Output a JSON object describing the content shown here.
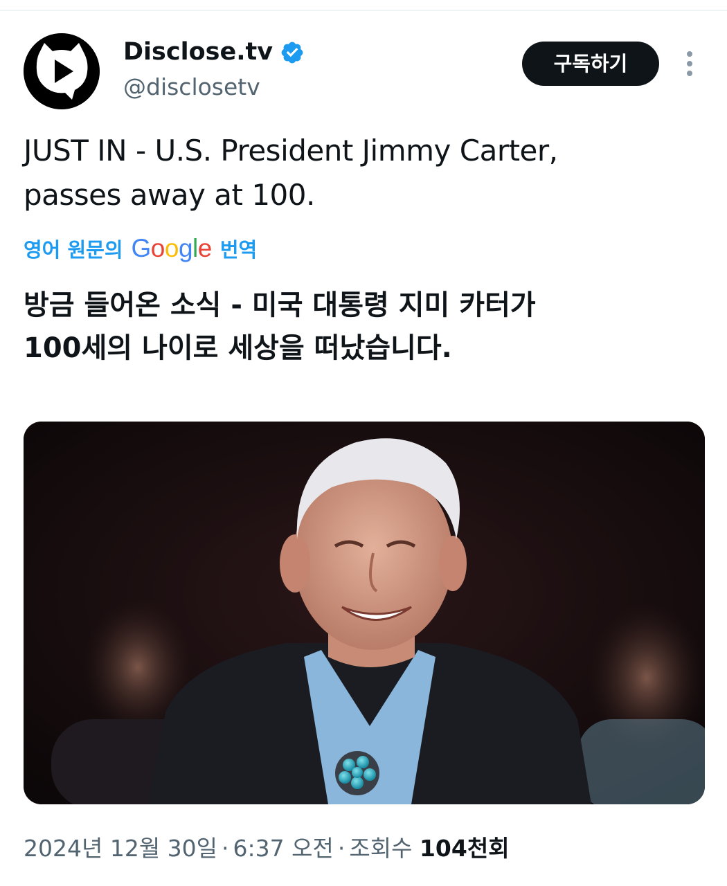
{
  "author": {
    "name": "Disclose.tv",
    "handle": "@disclosetv",
    "verified": true,
    "avatar_icon": "play-speech-bubble-icon"
  },
  "actions": {
    "subscribe_label": "구독하기",
    "more_icon": "more-vertical-icon"
  },
  "tweet": {
    "text_lines": [
      "JUST IN - U.S. President Jimmy Carter,",
      "passes away at 100."
    ],
    "translation": {
      "label_prefix": "영어 원문의",
      "google": [
        "G",
        "o",
        "o",
        "g",
        "l",
        "e"
      ],
      "label_suffix": "번역",
      "text_lines": [
        "방금 들어온 소식 - 미국 대통령 지미 카터가",
        "100세의 나이로 세상을 떠났습니다."
      ]
    }
  },
  "meta": {
    "date": "2024년 12월 30일",
    "separator": "·",
    "time": "6:37 오전",
    "views_label": "조회수",
    "views_count": "104천회"
  },
  "colors": {
    "text": "#0f1419",
    "secondary": "#536471",
    "link": "#1d9bf0",
    "verified": "#1d9bf0",
    "button_bg": "#0f1419",
    "google_blue": "#4285f4",
    "google_red": "#ea4335",
    "google_yellow": "#fbbc05",
    "google_green": "#34a853"
  }
}
